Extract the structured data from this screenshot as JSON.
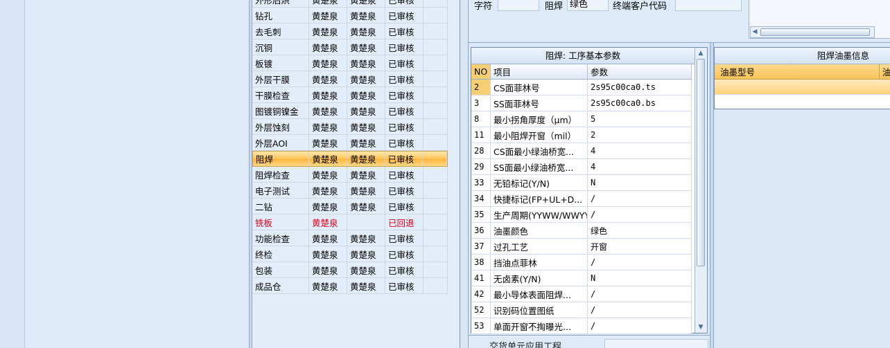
{
  "process_rows": [
    {
      "name": "外形后烘",
      "a": "黄楚泉",
      "b": "黄楚泉",
      "status": "已审核"
    },
    {
      "name": "钻孔",
      "a": "黄楚泉",
      "b": "黄楚泉",
      "status": "已审核"
    },
    {
      "name": "去毛刺",
      "a": "黄楚泉",
      "b": "黄楚泉",
      "status": "已审核"
    },
    {
      "name": "沉铜",
      "a": "黄楚泉",
      "b": "黄楚泉",
      "status": "已审核"
    },
    {
      "name": "板镀",
      "a": "黄楚泉",
      "b": "黄楚泉",
      "status": "已审核"
    },
    {
      "name": "外层干膜",
      "a": "黄楚泉",
      "b": "黄楚泉",
      "status": "已审核"
    },
    {
      "name": "干膜检查",
      "a": "黄楚泉",
      "b": "黄楚泉",
      "status": "已审核"
    },
    {
      "name": "图镀铜镍金",
      "a": "黄楚泉",
      "b": "黄楚泉",
      "status": "已审核"
    },
    {
      "name": "外层蚀刻",
      "a": "黄楚泉",
      "b": "黄楚泉",
      "status": "已审核"
    },
    {
      "name": "外层AOI",
      "a": "黄楚泉",
      "b": "黄楚泉",
      "status": "已审核"
    },
    {
      "name": "阻焊",
      "a": "黄楚泉",
      "b": "黄楚泉",
      "status": "已审核",
      "selected": true
    },
    {
      "name": "阻焊检查",
      "a": "黄楚泉",
      "b": "黄楚泉",
      "status": "已审核"
    },
    {
      "name": "电子测试",
      "a": "黄楚泉",
      "b": "黄楚泉",
      "status": "已审核"
    },
    {
      "name": "二钻",
      "a": "黄楚泉",
      "b": "黄楚泉",
      "status": "已审核"
    },
    {
      "name": "铣板",
      "a": "黄楚泉",
      "b": "",
      "status": "已回退",
      "red": true
    },
    {
      "name": "功能检查",
      "a": "黄楚泉",
      "b": "黄楚泉",
      "status": "已审核"
    },
    {
      "name": "终检",
      "a": "黄楚泉",
      "b": "黄楚泉",
      "status": "已审核"
    },
    {
      "name": "包装",
      "a": "黄楚泉",
      "b": "黄楚泉",
      "status": "已审核"
    },
    {
      "name": "成品仓",
      "a": "黄楚泉",
      "b": "黄楚泉",
      "status": "已审核"
    }
  ],
  "topform": {
    "label_char": "字符",
    "field_char": "",
    "label_solder": "阻焊",
    "field_solder": "绿色",
    "label_customer": "终端客户代码",
    "field_customer": ""
  },
  "param_grid": {
    "title": "阻焊: 工序基本参数",
    "head_no": "NO",
    "head_item": "项目",
    "head_param": "参数",
    "rows": [
      {
        "no": "2",
        "item": "CS面菲林号",
        "param": "2s95c00ca0.ts",
        "selected": true
      },
      {
        "no": "3",
        "item": "SS面菲林号",
        "param": "2s95c00ca0.bs"
      },
      {
        "no": "8",
        "item": "最小拐角厚度（μm）",
        "param": "5"
      },
      {
        "no": "11",
        "item": "最小阻焊开窗（mil）",
        "param": "2"
      },
      {
        "no": "28",
        "item": "CS面最小绿油桥宽...",
        "param": "4"
      },
      {
        "no": "29",
        "item": "SS面最小绿油桥宽...",
        "param": "4"
      },
      {
        "no": "33",
        "item": "无铅标记(Y/N)",
        "param": "N"
      },
      {
        "no": "34",
        "item": "快捷标记(FP+UL+D...",
        "param": "/"
      },
      {
        "no": "35",
        "item": "生产周期(YYWW/WWYY)",
        "param": "/"
      },
      {
        "no": "36",
        "item": "油墨颜色",
        "param": "绿色"
      },
      {
        "no": "37",
        "item": "过孔工艺",
        "param": "开窗"
      },
      {
        "no": "38",
        "item": "挡油点菲林",
        "param": "/"
      },
      {
        "no": "41",
        "item": "无卤素(Y/N)",
        "param": "N"
      },
      {
        "no": "42",
        "item": "最小导体表面阻焊...",
        "param": "/"
      },
      {
        "no": "52",
        "item": "识别码位置图纸",
        "param": "/"
      },
      {
        "no": "53",
        "item": "单面开窗不掏曝光...",
        "param": "/"
      }
    ]
  },
  "ink_grid": {
    "title": "阻焊油墨信息",
    "head_model": "油墨型号",
    "head_next": "油"
  },
  "bottom_bar": {
    "label": "交货单元应用工程"
  }
}
